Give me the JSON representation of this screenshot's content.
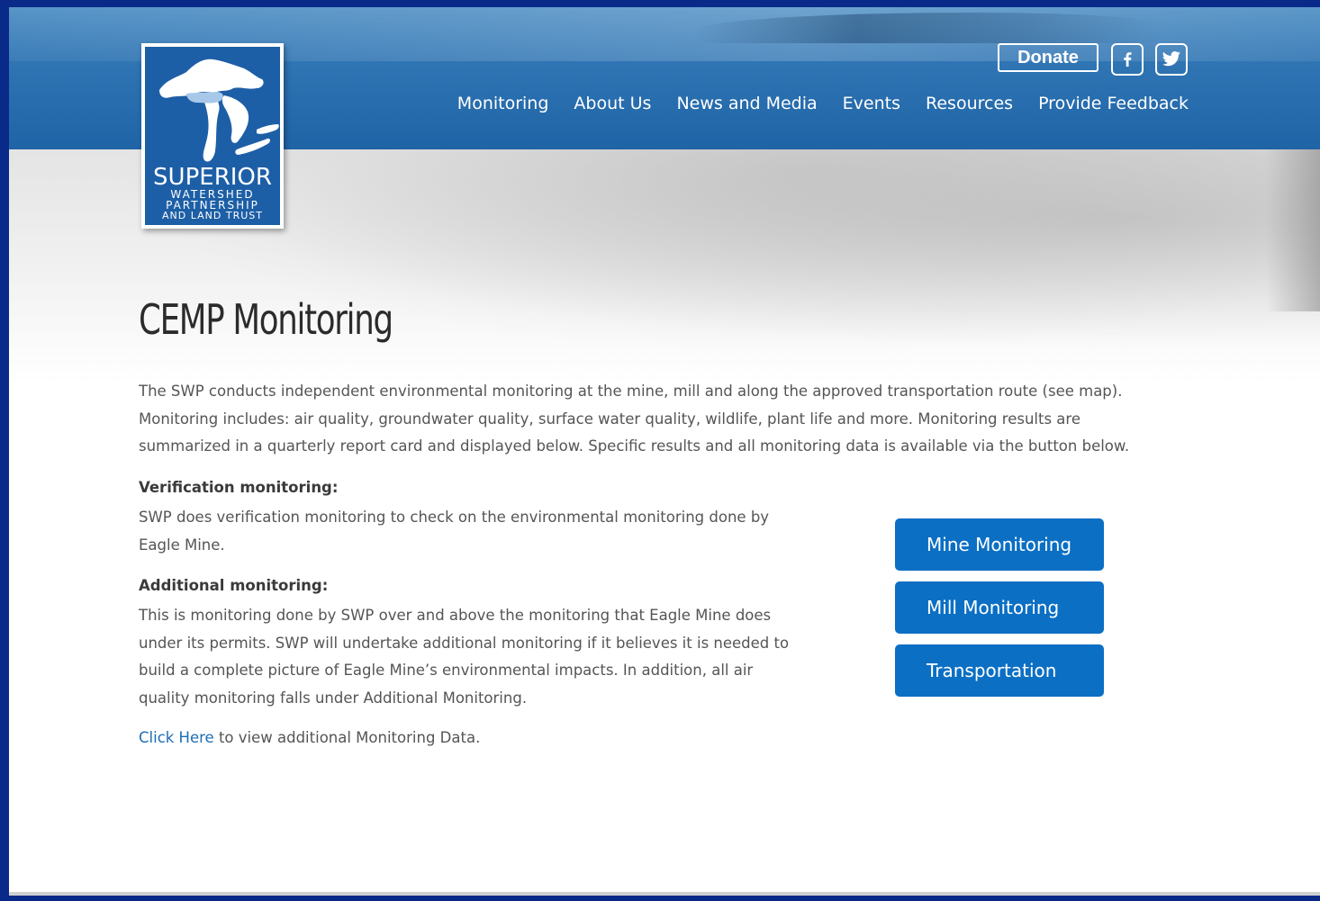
{
  "header": {
    "donate_label": "Donate",
    "social": [
      {
        "name": "facebook-icon",
        "glyph": "f"
      },
      {
        "name": "twitter-icon"
      }
    ],
    "nav": [
      {
        "label": "Monitoring"
      },
      {
        "label": "About Us"
      },
      {
        "label": "News and Media"
      },
      {
        "label": "Events"
      },
      {
        "label": "Resources"
      },
      {
        "label": "Provide Feedback"
      }
    ]
  },
  "logo": {
    "title": "SUPERIOR",
    "line1": "WATERSHED",
    "line2": "PARTNERSHIP",
    "line3": "AND LAND TRUST"
  },
  "main": {
    "title": "CEMP Monitoring",
    "intro": "The SWP conducts independent environmental monitoring at the mine, mill and along the approved transportation route (see map). Monitoring includes: air quality, groundwater quality, surface water quality, wildlife, plant life and more. Monitoring results are summarized in a quarterly report card and displayed below. Specific results and all monitoring data is available via the button below.",
    "verification": {
      "heading": "Verification monitoring:",
      "body": "SWP does verification monitoring to check on the environmental monitoring done by Eagle Mine."
    },
    "additional": {
      "heading": "Additional monitoring:",
      "body": "This is monitoring done by SWP over and above the monitoring that Eagle Mine does under its permits. SWP will undertake additional monitoring if it believes it is needed to build a complete picture of Eagle Mine’s environmental impacts. In addition, all air quality monitoring falls under Additional Monitoring."
    },
    "link": {
      "label": "Click Here",
      "suffix": " to view additional Monitoring Data."
    },
    "buttons": [
      {
        "label": "Mine Monitoring"
      },
      {
        "label": "Mill Monitoring"
      },
      {
        "label": "Transportation"
      }
    ]
  },
  "colors": {
    "header_blue": "#1f64a6",
    "button_blue": "#0b6fc4",
    "link_blue": "#1d6eb3",
    "outer_frame": "#0a2a8a"
  }
}
